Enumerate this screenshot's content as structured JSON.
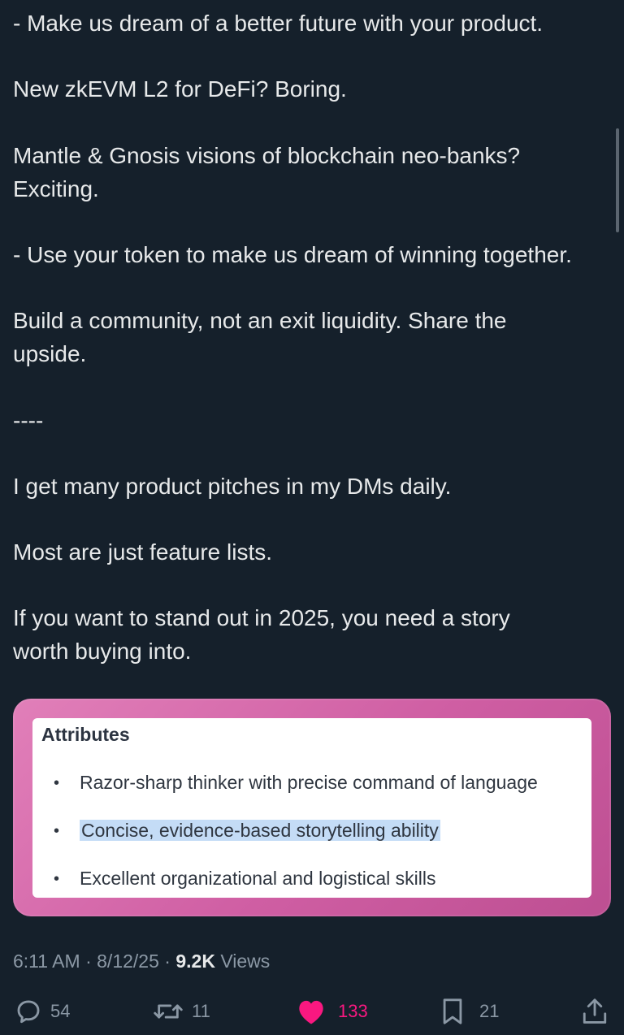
{
  "post": {
    "paragraphs": [
      {
        "lines": [
          "- Make us dream of a better future with your product."
        ]
      },
      {
        "lines": [
          "New zkEVM L2 for DeFi? Boring."
        ]
      },
      {
        "lines": [
          "Mantle & Gnosis visions of blockchain neo-banks?",
          "Exciting."
        ]
      },
      {
        "lines": [
          "- Use your token to make us dream of winning together."
        ]
      },
      {
        "lines": [
          "Build a community, not an exit liquidity. Share the",
          "upside."
        ]
      },
      {
        "lines": [
          "----"
        ]
      },
      {
        "lines": [
          "I get many product pitches in my DMs daily."
        ]
      },
      {
        "lines": [
          "Most are just feature lists."
        ]
      },
      {
        "lines": [
          "If you want to stand out in 2025, you need a story",
          "worth buying into."
        ]
      }
    ]
  },
  "attached_image": {
    "heading": "Attributes",
    "items": [
      {
        "text": "Razor-sharp thinker with precise command of language",
        "highlighted": false
      },
      {
        "text": "Concise, evidence-based storytelling ability",
        "highlighted": true
      },
      {
        "text": "Excellent organizational and logistical skills",
        "highlighted": false
      }
    ],
    "bullet": "•",
    "frame_color": "#d56aa9",
    "highlight_color": "#c4dcf6"
  },
  "meta": {
    "time": "6:11 AM",
    "sep1": " · ",
    "date": "8/12/25",
    "sep2": " · ",
    "views_count": "9.2K",
    "views_label": " Views"
  },
  "actions": {
    "replies": {
      "icon": "reply-icon",
      "count": "54"
    },
    "reposts": {
      "icon": "repost-icon",
      "count": "11"
    },
    "likes": {
      "icon": "heart-icon",
      "count": "133",
      "liked": true,
      "color": "#f91880"
    },
    "bookmarks": {
      "icon": "bookmark-icon",
      "count": "21"
    },
    "share": {
      "icon": "share-icon"
    }
  },
  "colors": {
    "background": "#15202b",
    "text": "#e7e9ea",
    "muted": "#8b98a5"
  }
}
